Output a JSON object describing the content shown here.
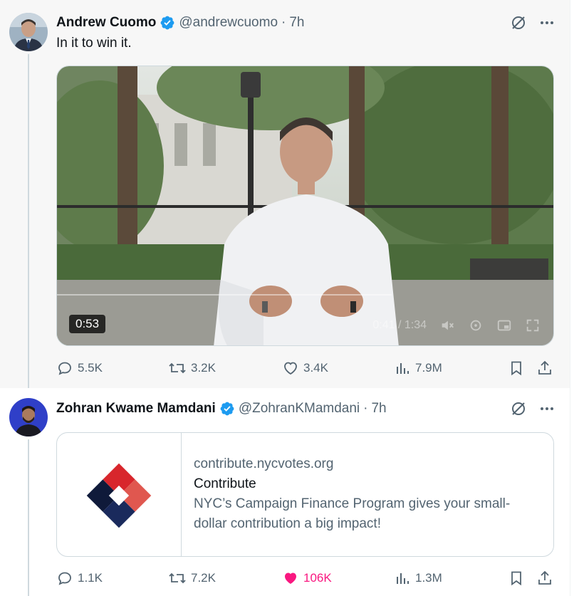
{
  "tweets": [
    {
      "author_name": "Andrew Cuomo",
      "handle": "@andrewcuomo",
      "separator": "·",
      "time": "7h",
      "text": "In it to win it.",
      "media": {
        "duration": "0:53",
        "player_time": "0:41 / 1:34",
        "progress": 0.44
      },
      "actions": {
        "replies": "5.5K",
        "reposts": "3.2K",
        "likes": "3.4K",
        "views": "7.9M"
      },
      "liked": false
    },
    {
      "author_name": "Zohran Kwame Mamdani",
      "handle": "@ZohranKMamdani",
      "separator": "·",
      "time": "7h",
      "card": {
        "domain": "contribute.nycvotes.org",
        "title": "Contribute",
        "description_line1": "NYC’s Campaign Finance Program gives your small-",
        "description_line2": "dollar contribution a big impact!"
      },
      "actions": {
        "replies": "1.1K",
        "reposts": "7.2K",
        "likes": "106K",
        "views": "1.3M"
      },
      "liked": true
    }
  ],
  "icons": {
    "verified": "verified-badge-icon",
    "grok": "grok-icon",
    "more": "more-icon",
    "reply": "reply-icon",
    "repost": "repost-icon",
    "like": "heart-icon",
    "views": "views-icon",
    "bookmark": "bookmark-icon",
    "share": "share-icon"
  },
  "colors": {
    "verified": "#1d9bf0",
    "like_active": "#f91880",
    "muted_text": "#536471",
    "card_logo_red": "#d8262c",
    "card_logo_navy": "#1a2a5c"
  }
}
